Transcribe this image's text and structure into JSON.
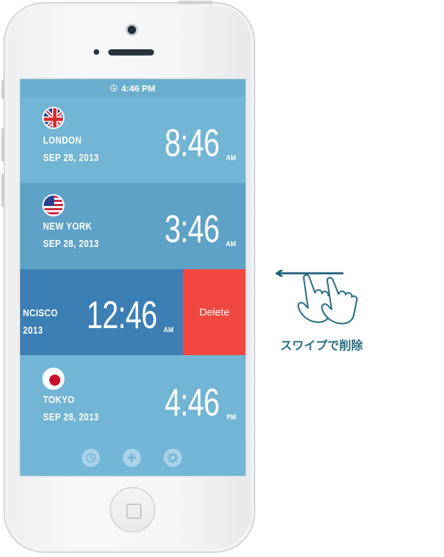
{
  "status_bar": {
    "time": "4:46 PM"
  },
  "clocks": [
    {
      "city": "LONDON",
      "date": "SEP 28, 2013",
      "time": "8:46",
      "ampm": "AM",
      "flag": "uk-flag",
      "bg": "#72b5d4"
    },
    {
      "city": "NEW YORK",
      "date": "SEP 28, 2013",
      "time": "3:46",
      "ampm": "AM",
      "flag": "us-flag",
      "bg": "#5ea2c7"
    },
    {
      "city": "NCISCO",
      "date": "2013",
      "time": "12:46",
      "ampm": "AM",
      "flag": "",
      "bg": "#3b7fb4"
    },
    {
      "city": "TOKYO",
      "date": "SEP 28, 2013",
      "time": "4:46",
      "ampm": "PM",
      "flag": "japan-flag",
      "bg": "#72b5d4"
    }
  ],
  "delete_label": "Delete",
  "toolbar": {
    "icons": [
      "timer-icon",
      "add-icon",
      "settings-icon"
    ]
  },
  "hint": {
    "text": "スワイプで削除",
    "color": "#2a6f85"
  }
}
